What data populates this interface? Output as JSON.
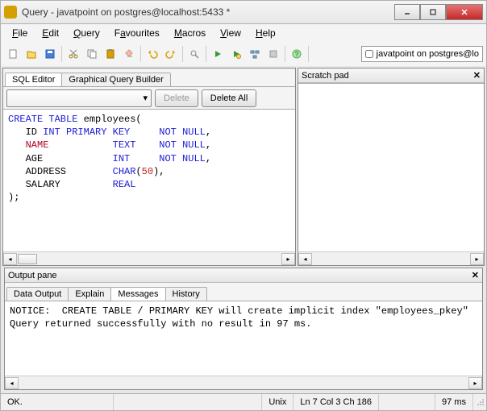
{
  "titlebar": {
    "title": "Query - javatpoint on postgres@localhost:5433 *"
  },
  "menubar": {
    "items": [
      {
        "label": "File",
        "u": "F"
      },
      {
        "label": "Edit",
        "u": "E"
      },
      {
        "label": "Query",
        "u": "Q"
      },
      {
        "label": "Favourites",
        "u": "a"
      },
      {
        "label": "Macros",
        "u": "M"
      },
      {
        "label": "View",
        "u": "V"
      },
      {
        "label": "Help",
        "u": "H"
      }
    ]
  },
  "toolbar": {
    "connection_label": "javatpoint on postgres@lo"
  },
  "left_tabs": {
    "t0": "SQL Editor",
    "t1": "Graphical Query Builder"
  },
  "editor_toolbar": {
    "delete": "Delete",
    "delete_all": "Delete All"
  },
  "sql": {
    "line1_a": "CREATE TABLE",
    "line1_b": " employees(",
    "line2_a": "   ID ",
    "line2_b": "INT PRIMARY KEY",
    "line2_c": "     ",
    "line2_d": "NOT NULL",
    "line2_e": ",",
    "line3_a": "   ",
    "line3_b": "NAME",
    "line3_c": "           ",
    "line3_d": "TEXT",
    "line3_e": "    ",
    "line3_f": "NOT NULL",
    "line3_g": ",",
    "line4_a": "   AGE            ",
    "line4_b": "INT",
    "line4_c": "     ",
    "line4_d": "NOT NULL",
    "line4_e": ",",
    "line5_a": "   ADDRESS        ",
    "line5_b": "CHAR",
    "line5_c": "(",
    "line5_d": "50",
    "line5_e": "),",
    "line6_a": "   SALARY         ",
    "line6_b": "REAL",
    "line7": ");"
  },
  "scratch": {
    "title": "Scratch pad"
  },
  "output": {
    "title": "Output pane",
    "tabs": {
      "t0": "Data Output",
      "t1": "Explain",
      "t2": "Messages",
      "t3": "History"
    },
    "text": "NOTICE:  CREATE TABLE / PRIMARY KEY will create implicit index \"employees_pkey\"\nQuery returned successfully with no result in 97 ms."
  },
  "statusbar": {
    "s0": "OK.",
    "s1": "Unix",
    "s2": "Ln 7 Col 3 Ch 186",
    "s3": "97 ms"
  }
}
